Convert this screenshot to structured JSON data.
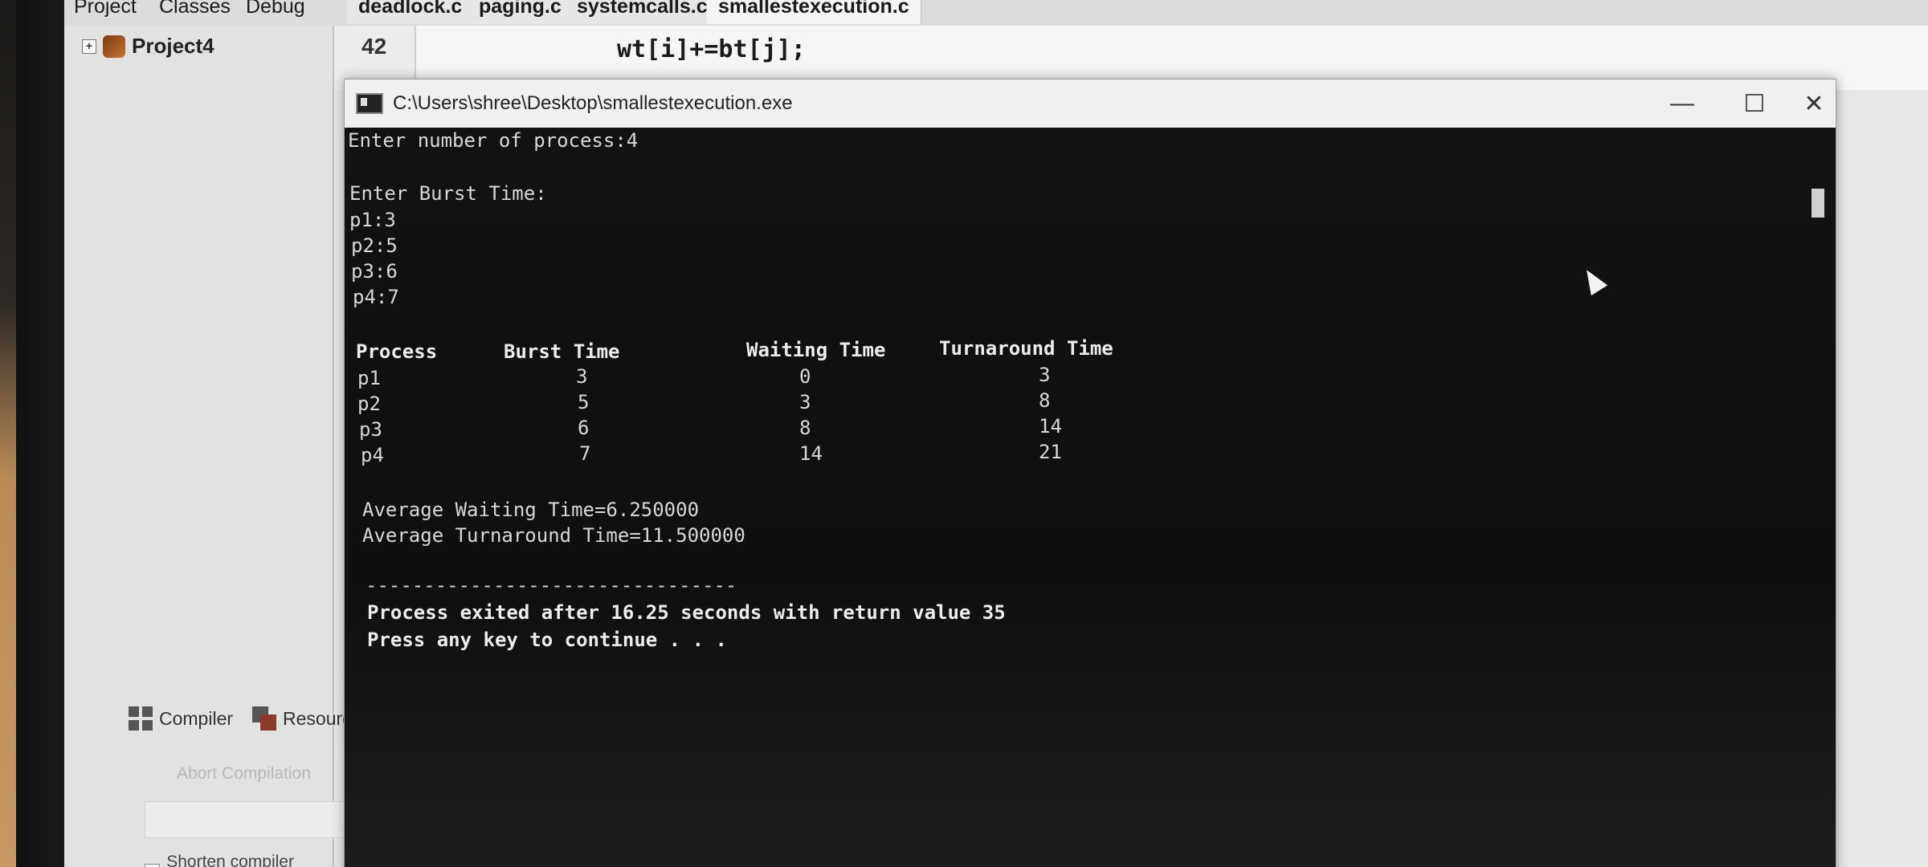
{
  "ide": {
    "menu": [
      "Project",
      "Classes",
      "Debug"
    ],
    "tabs": [
      "deadlock.c",
      "paging.c",
      "systemcalls.c",
      "smallestexecution.c"
    ],
    "active_tab": "smallestexecution.c",
    "project_tree": {
      "root": "Project4"
    },
    "editor": {
      "line_number": "42",
      "code_line": "wt[i]+=bt[j];"
    },
    "bottom_tabs": {
      "compiler": "Compiler",
      "resources": "Resource"
    },
    "abort_button": "Abort Compilation",
    "shorten_paths": "Shorten compiler paths"
  },
  "console": {
    "title": "C:\\Users\\shree\\Desktop\\smallestexecution.exe",
    "lines": {
      "prompt_count": "Enter number of process:4",
      "prompt_burst": "Enter Burst Time:",
      "burst_inputs": [
        "p1:3",
        "p2:5",
        "p3:6",
        "p4:7"
      ]
    },
    "table": {
      "headers": [
        "Process",
        "Burst Time",
        "Waiting Time",
        "Turnaround Time"
      ],
      "rows": [
        [
          "p1",
          "3",
          "0",
          "3"
        ],
        [
          "p2",
          "5",
          "3",
          "8"
        ],
        [
          "p3",
          "6",
          "8",
          "14"
        ],
        [
          "p4",
          "7",
          "14",
          "21"
        ]
      ]
    },
    "avg_waiting": "Average Waiting Time=6.250000",
    "avg_turnaround": "Average Turnaround Time=11.500000",
    "separator": "--------------------------------",
    "exit_message": "Process exited after 16.25 seconds with return value 35",
    "continue_prompt": "Press any key to continue . . ."
  },
  "icons": {
    "minimize": "minimize-icon",
    "maximize": "maximize-icon",
    "close": "close-icon"
  }
}
